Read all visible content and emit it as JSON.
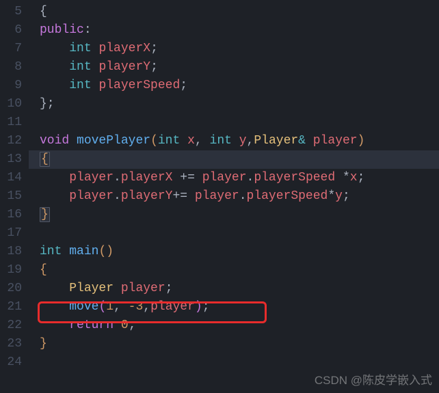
{
  "gutter_start": 5,
  "gutter_end": 24,
  "current_line": 13,
  "lines": {
    "5": [
      [
        "punct",
        "{"
      ]
    ],
    "6": [
      [
        "kw",
        "public"
      ],
      [
        "punct",
        ":"
      ]
    ],
    "7": [
      [
        "ident",
        "    "
      ],
      [
        "type",
        "int"
      ],
      [
        "ident",
        " "
      ],
      [
        "var",
        "playerX"
      ],
      [
        "punct",
        ";"
      ]
    ],
    "8": [
      [
        "ident",
        "    "
      ],
      [
        "type",
        "int"
      ],
      [
        "ident",
        " "
      ],
      [
        "var",
        "playerY"
      ],
      [
        "punct",
        ";"
      ]
    ],
    "9": [
      [
        "ident",
        "    "
      ],
      [
        "type",
        "int"
      ],
      [
        "ident",
        " "
      ],
      [
        "var",
        "playerSpeed"
      ],
      [
        "punct",
        ";"
      ]
    ],
    "10": [
      [
        "punct",
        "};"
      ]
    ],
    "11": [],
    "12": [
      [
        "kw",
        "void"
      ],
      [
        "ident",
        " "
      ],
      [
        "func",
        "movePlayer"
      ],
      [
        "bracket1",
        "("
      ],
      [
        "type",
        "int"
      ],
      [
        "ident",
        " "
      ],
      [
        "var",
        "x"
      ],
      [
        "punct",
        ", "
      ],
      [
        "type",
        "int"
      ],
      [
        "ident",
        " "
      ],
      [
        "var",
        "y"
      ],
      [
        "punct",
        ","
      ],
      [
        "cls",
        "Player"
      ],
      [
        "type",
        "&"
      ],
      [
        "ident",
        " "
      ],
      [
        "var",
        "player"
      ],
      [
        "bracket1",
        ")"
      ]
    ],
    "13": [
      [
        "bracket1",
        "{"
      ]
    ],
    "14": [
      [
        "ident",
        "    "
      ],
      [
        "var",
        "player"
      ],
      [
        "punct",
        "."
      ],
      [
        "var",
        "playerX"
      ],
      [
        "ident",
        " "
      ],
      [
        "punct",
        "+="
      ],
      [
        "ident",
        " "
      ],
      [
        "var",
        "player"
      ],
      [
        "punct",
        "."
      ],
      [
        "var",
        "playerSpeed"
      ],
      [
        "ident",
        " "
      ],
      [
        "punct",
        "*"
      ],
      [
        "var",
        "x"
      ],
      [
        "punct",
        ";"
      ]
    ],
    "15": [
      [
        "ident",
        "    "
      ],
      [
        "var",
        "player"
      ],
      [
        "punct",
        "."
      ],
      [
        "var",
        "playerY"
      ],
      [
        "punct",
        "+="
      ],
      [
        "ident",
        " "
      ],
      [
        "var",
        "player"
      ],
      [
        "punct",
        "."
      ],
      [
        "var",
        "playerSpeed"
      ],
      [
        "punct",
        "*"
      ],
      [
        "var",
        "y"
      ],
      [
        "punct",
        ";"
      ]
    ],
    "16": [
      [
        "bracket1",
        "}"
      ]
    ],
    "17": [],
    "18": [
      [
        "type",
        "int"
      ],
      [
        "ident",
        " "
      ],
      [
        "func",
        "main"
      ],
      [
        "bracket1",
        "()"
      ]
    ],
    "19": [
      [
        "bracket1",
        "{"
      ]
    ],
    "20": [
      [
        "ident",
        "    "
      ],
      [
        "cls",
        "Player"
      ],
      [
        "ident",
        " "
      ],
      [
        "var",
        "player"
      ],
      [
        "punct",
        ";"
      ]
    ],
    "21": [
      [
        "ident",
        "    "
      ],
      [
        "func",
        "move"
      ],
      [
        "bracket2",
        "("
      ],
      [
        "num",
        "1"
      ],
      [
        "punct",
        ", "
      ],
      [
        "num",
        "-3"
      ],
      [
        "punct",
        ","
      ],
      [
        "var",
        "player"
      ],
      [
        "bracket2",
        ")"
      ],
      [
        "punct",
        ";"
      ]
    ],
    "22": [
      [
        "ident",
        "    "
      ],
      [
        "kw",
        "return"
      ],
      [
        "ident",
        " "
      ],
      [
        "num",
        "0"
      ],
      [
        "punct",
        ";"
      ]
    ],
    "23": [
      [
        "bracket1",
        "}"
      ]
    ],
    "24": []
  },
  "highlight_box_line": 21,
  "watermark": "CSDN @陈皮学嵌入式"
}
